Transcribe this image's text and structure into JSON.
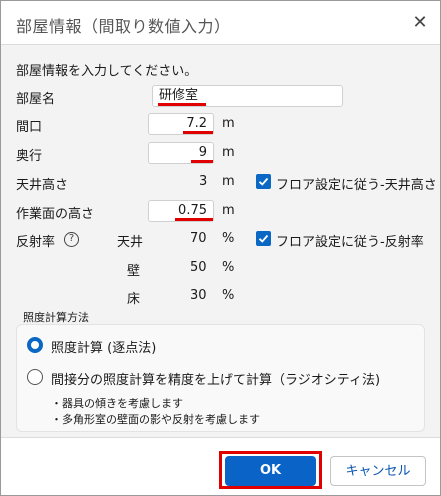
{
  "dialog": {
    "title": "部屋情報（間取り数値入力）",
    "close_symbol": "✕"
  },
  "instruction": "部屋情報を入力してください。",
  "fields": {
    "room_name": {
      "label": "部屋名",
      "value": "研修室"
    },
    "frontage": {
      "label": "間口",
      "value": "7.2",
      "unit": "m"
    },
    "depth": {
      "label": "奥行",
      "value": "9",
      "unit": "m"
    },
    "ceiling_height": {
      "label": "天井高さ",
      "value": "3",
      "unit": "m",
      "checkbox_label": "フロア設定に従う-天井高さ",
      "checked": true
    },
    "work_plane": {
      "label": "作業面の高さ",
      "value": "0.75",
      "unit": "m"
    }
  },
  "reflectance": {
    "label": "反射率",
    "help_symbol": "?",
    "checkbox_label": "フロア設定に従う-反射率",
    "checked": true,
    "rows": [
      {
        "surface": "天井",
        "value": "70",
        "unit": "%"
      },
      {
        "surface": "壁",
        "value": "50",
        "unit": "%"
      },
      {
        "surface": "床",
        "value": "30",
        "unit": "%"
      }
    ]
  },
  "calc_method": {
    "heading": "照度計算方法",
    "options": [
      {
        "label": "照度計算 (逐点法)",
        "selected": true
      },
      {
        "label": "間接分の照度計算を精度を上げて計算（ラジオシティ法)",
        "selected": false
      }
    ],
    "notes": [
      "・器具の傾きを考慮します",
      "・多角形室の壁面の影や反射を考慮します"
    ]
  },
  "buttons": {
    "ok": "OK",
    "cancel": "キャンセル"
  },
  "colors": {
    "accent": "#0a67c4",
    "highlight_red": "#e00000"
  }
}
